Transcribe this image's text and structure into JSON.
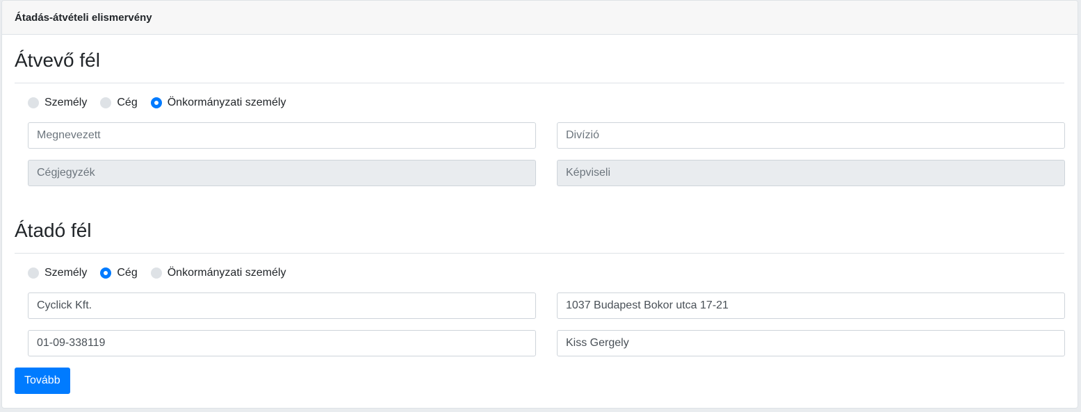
{
  "header": {
    "title": "Átadás-átvételi elismervény"
  },
  "receiver": {
    "title": "Átvevő fél",
    "options": [
      {
        "label": "Személy",
        "checked": false
      },
      {
        "label": "Cég",
        "checked": false
      },
      {
        "label": "Önkormányzati személy",
        "checked": true
      }
    ],
    "fields": {
      "name": {
        "placeholder": "Megnevezett",
        "value": "",
        "disabled": false
      },
      "division": {
        "placeholder": "Divízió",
        "value": "",
        "disabled": false
      },
      "registry": {
        "placeholder": "Cégjegyzék",
        "value": "",
        "disabled": true
      },
      "representative": {
        "placeholder": "Képviseli",
        "value": "",
        "disabled": true
      }
    }
  },
  "sender": {
    "title": "Átadó fél",
    "options": [
      {
        "label": "Személy",
        "checked": false
      },
      {
        "label": "Cég",
        "checked": true
      },
      {
        "label": "Önkormányzati személy",
        "checked": false
      }
    ],
    "fields": {
      "name": {
        "placeholder": "",
        "value": "Cyclick Kft.",
        "disabled": false
      },
      "address": {
        "placeholder": "",
        "value": "1037 Budapest Bokor utca 17-21",
        "disabled": false
      },
      "registry": {
        "placeholder": "",
        "value": "01-09-338119",
        "disabled": false
      },
      "representative": {
        "placeholder": "",
        "value": "Kiss Gergely",
        "disabled": false
      }
    }
  },
  "actions": {
    "next_label": "Tovább"
  },
  "colors": {
    "primary": "#007bff",
    "radio_unchecked": "#dee2e6",
    "disabled_bg": "#e9ecef"
  }
}
